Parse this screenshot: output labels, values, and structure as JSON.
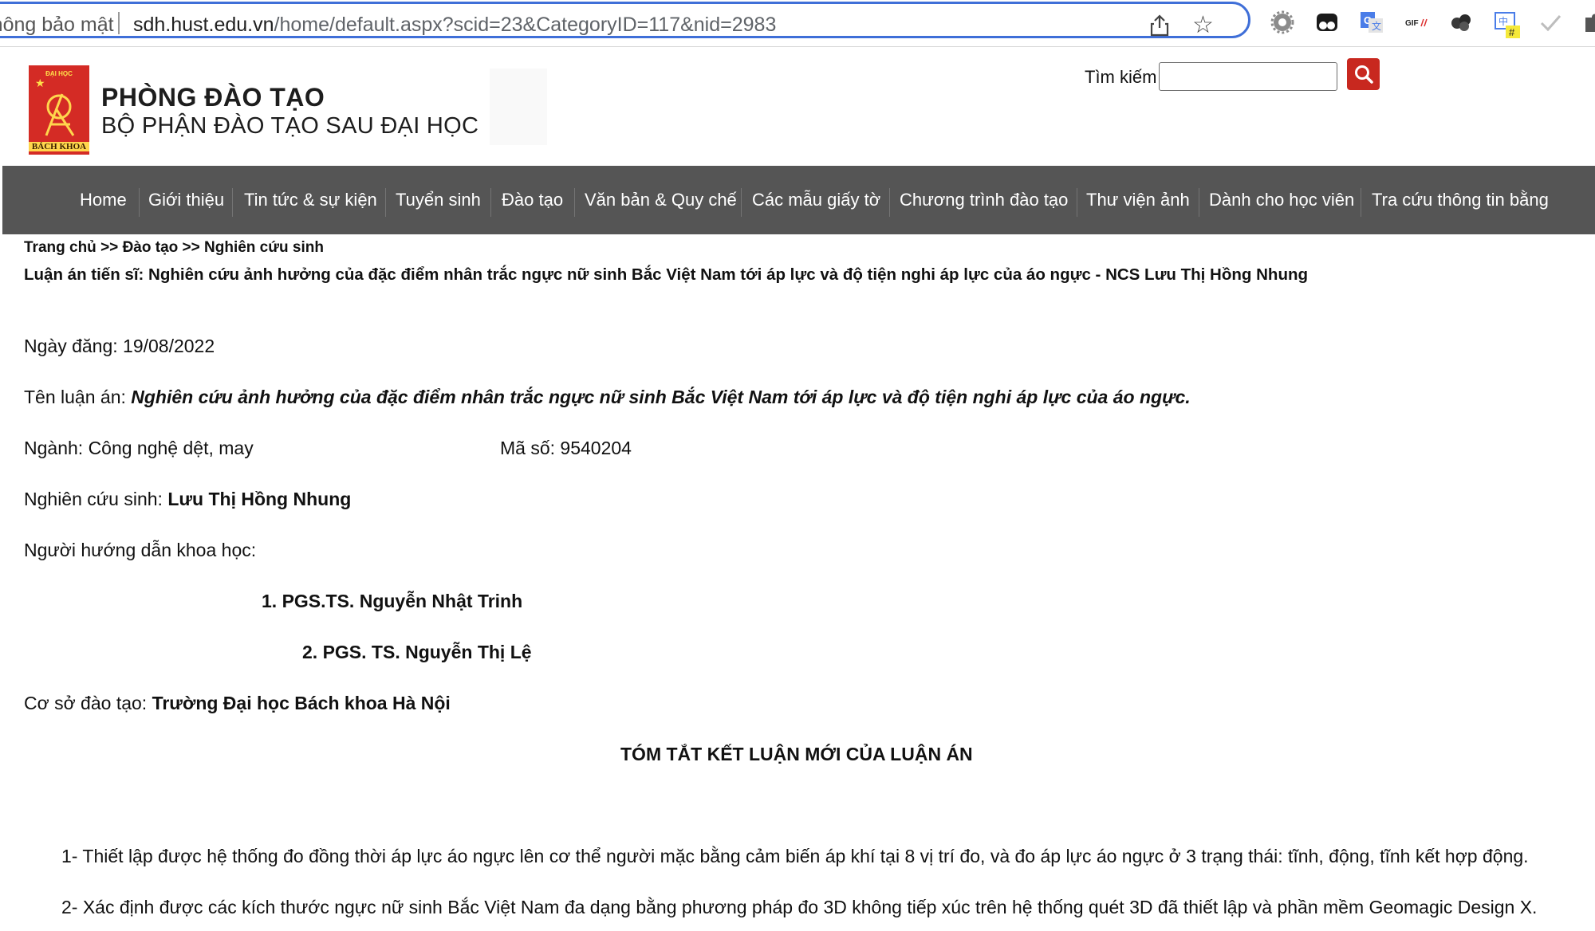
{
  "browser": {
    "security_label": "Không bảo mật",
    "url_host": "sdh.hust.edu.vn",
    "url_path": "/home/default.aspx?scid=23&CategoryID=117&nid=2983",
    "extensions": [
      "settings-extension-icon",
      "tampermonkey-extension-icon",
      "google-translate-extension-icon",
      "gif-extension-icon",
      "dots-extension-icon",
      "translate-hash-extension-icon",
      "check-extension-icon",
      "puzzle-extension-icon"
    ],
    "ext_gif_text": "GIF",
    "ext_badge_text": "#"
  },
  "header": {
    "logo_top_text": "ĐẠI HỌC",
    "logo_bottom_text": "BÁCH KHOA",
    "title": "PHÒNG ĐÀO TẠO",
    "subtitle": "BỘ PHẬN ĐÀO TẠO SAU ĐẠI HỌC",
    "search_label": "Tìm kiếm",
    "search_value": "",
    "accent_color": "#c8281f"
  },
  "nav": {
    "items": [
      "Home",
      "Giới thiệu",
      "Tin tức & sự kiện",
      "Tuyển sinh",
      "Đào tạo",
      "Văn bản & Quy chế",
      "Các mẫu giấy tờ",
      "Chương trình đào tạo",
      "Thư viện ảnh",
      "Dành cho học viên",
      "Tra cứu thông tin bằng"
    ],
    "background": "#555555"
  },
  "breadcrumb": {
    "home": "Trang chủ",
    "sep": ">>",
    "level1": "Đào tạo",
    "level2": "Nghiên cứu sinh"
  },
  "article": {
    "title": "Luận án tiến sĩ: Nghiên cứu ảnh hưởng của đặc điểm nhân trắc ngực nữ sinh Bắc Việt Nam tới áp lực và độ tiện nghi áp lực của áo ngực - NCS Lưu Thị Hồng Nhung",
    "date_label": "Ngày đăng: ",
    "date_value": "19/08/2022",
    "thesis_label": "Tên luận án: ",
    "thesis_value": "Nghiên cứu ảnh hưởng của đặc điểm nhân trắc ngực nữ sinh Bắc Việt Nam tới áp lực và độ tiện nghi áp lực của áo ngực.",
    "major_label": "Ngành: ",
    "major_value": "Công nghệ dệt, may",
    "code_label": "Mã số: ",
    "code_value": "9540204",
    "student_label": "Nghiên cứu sinh: ",
    "student_value": "Lưu Thị Hồng Nhung",
    "advisor_label": "Người hướng dẫn khoa học:",
    "advisors": [
      "1. PGS.TS. Nguyễn Nhật Trinh",
      "2. PGS. TS. Nguyễn Thị Lệ"
    ],
    "institution_label": "Cơ sở đào tạo: ",
    "institution_value": "Trường Đại học Bách khoa Hà Nội",
    "summary_heading": "TÓM TẮT KẾT LUẬN MỚI CỦA LUẬN ÁN",
    "conclusions": [
      "1- Thiết lập được hệ thống đo đồng thời áp lực áo ngực lên cơ thể người mặc bằng cảm biến áp khí tại 8 vị trí đo, và đo áp lực áo ngực ở 3 trạng thái: tĩnh, động, tĩnh kết hợp động.",
      "2- Xác định được các kích thước ngực nữ sinh Bắc Việt Nam đa dạng bằng phương pháp đo 3D không tiếp xúc trên hệ thống quét 3D đã thiết lập và phần mềm Geomagic Design X."
    ]
  }
}
